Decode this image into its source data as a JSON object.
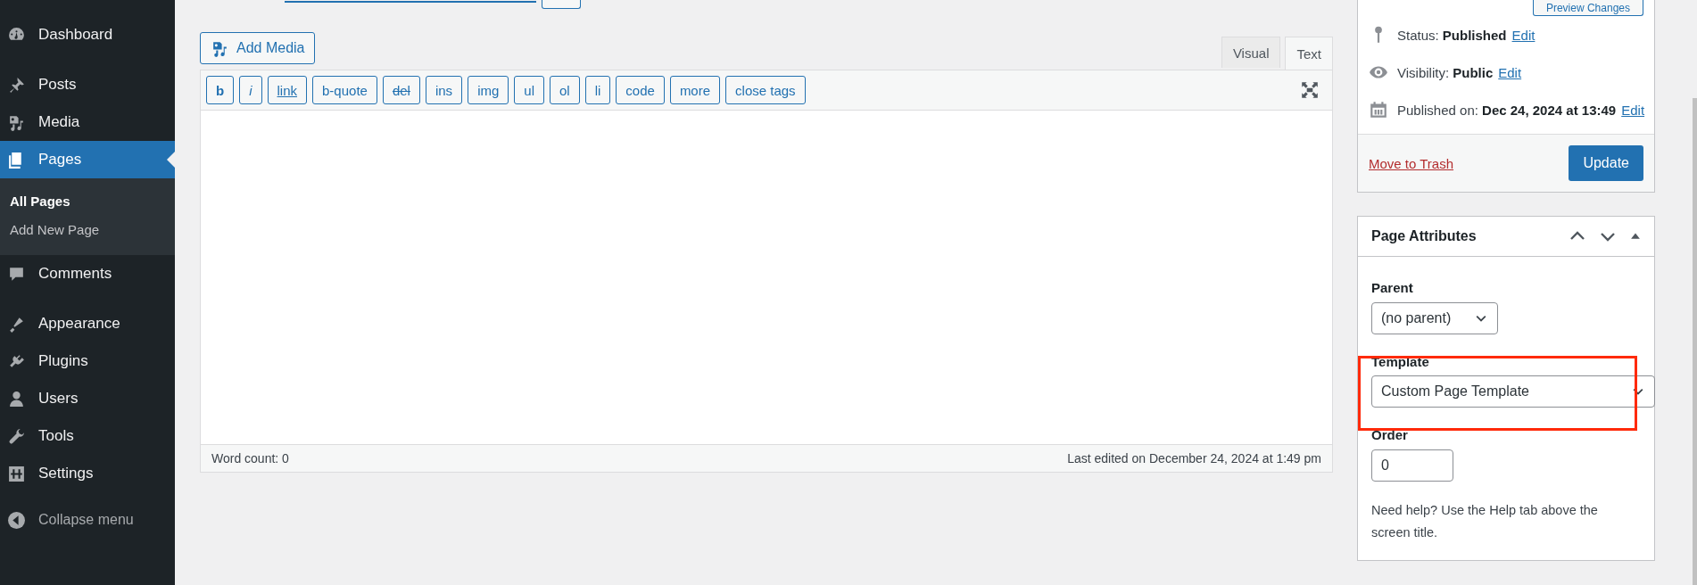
{
  "sidebar": {
    "groups": [
      [
        {
          "label": "Dashboard",
          "selected": false
        }
      ],
      [
        {
          "label": "Posts",
          "selected": false
        },
        {
          "label": "Media",
          "selected": false
        },
        {
          "label": "Pages",
          "selected": true,
          "children": [
            {
              "label": "All Pages",
              "selected": true
            },
            {
              "label": "Add New Page",
              "selected": false
            }
          ]
        },
        {
          "label": "Comments",
          "selected": false
        }
      ],
      [
        {
          "label": "Appearance",
          "selected": false
        },
        {
          "label": "Plugins",
          "selected": false
        },
        {
          "label": "Users",
          "selected": false
        },
        {
          "label": "Tools",
          "selected": false
        },
        {
          "label": "Settings",
          "selected": false
        }
      ]
    ],
    "collapse": "Collapse menu"
  },
  "editor": {
    "add_media": "Add Media",
    "tabs": [
      {
        "label": "Visual",
        "selected": false
      },
      {
        "label": "Text",
        "selected": true
      }
    ],
    "quicktags": [
      {
        "label": "b",
        "kind": "bold"
      },
      {
        "label": "i",
        "kind": "italic"
      },
      {
        "label": "link",
        "kind": "link"
      },
      {
        "label": "b-quote",
        "kind": "plain"
      },
      {
        "label": "del",
        "kind": "strike"
      },
      {
        "label": "ins",
        "kind": "plain"
      },
      {
        "label": "img",
        "kind": "plain"
      },
      {
        "label": "ul",
        "kind": "plain"
      },
      {
        "label": "ol",
        "kind": "plain"
      },
      {
        "label": "li",
        "kind": "plain"
      },
      {
        "label": "code",
        "kind": "plain"
      },
      {
        "label": "more",
        "kind": "plain"
      },
      {
        "label": "close tags",
        "kind": "plain"
      }
    ],
    "word_count": "Word count: 0",
    "last_edited": "Last edited on December 24, 2024 at 1:49 pm"
  },
  "publish": {
    "preview": "Preview Changes",
    "rows": [
      {
        "text": "Status: **Published**",
        "link": "Edit"
      },
      {
        "text": "Visibility: **Public**",
        "link": "Edit"
      },
      {
        "text": "Published on: **Dec 24, 2024 at 13:49**",
        "link": "Edit"
      }
    ],
    "trash": "Move to Trash",
    "update": "Update"
  },
  "page_attributes": {
    "title": "Page Attributes",
    "parent": {
      "label": "Parent",
      "value": "(no parent)"
    },
    "template": {
      "label": "Template",
      "value": "Custom Page Template",
      "highlighted": true
    },
    "order": {
      "label": "Order",
      "value": "0"
    },
    "help": "Need help? Use the Help tab above the screen title."
  }
}
